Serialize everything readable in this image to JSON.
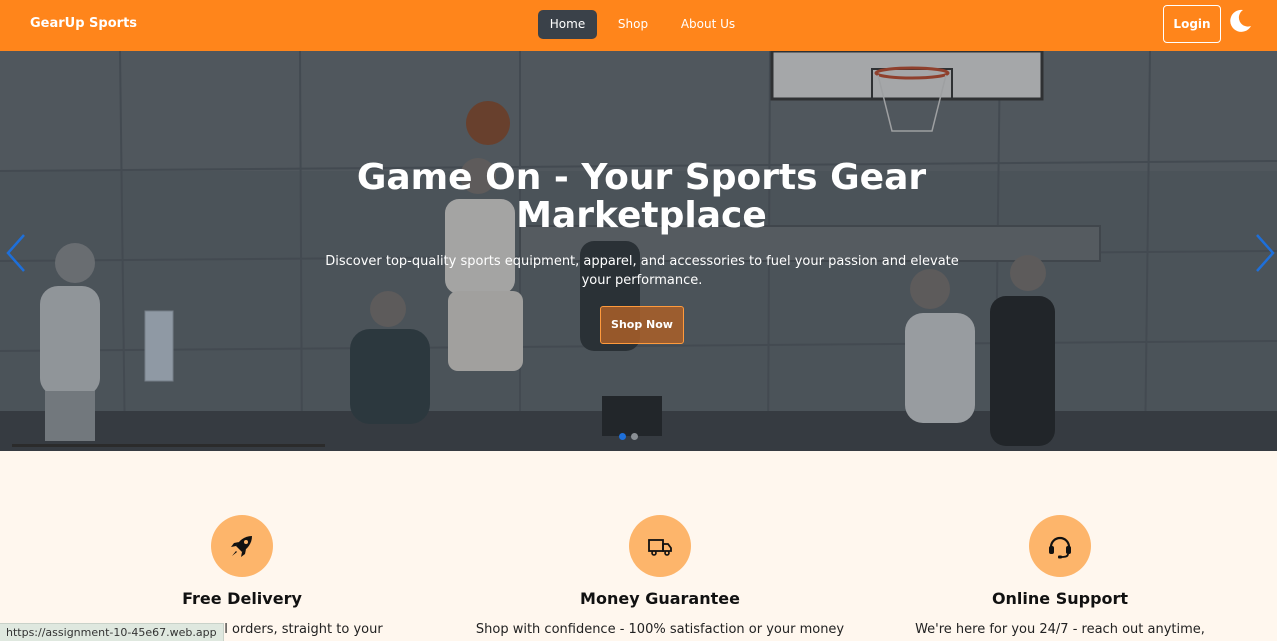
{
  "navbar": {
    "brand": "GearUp Sports",
    "links": [
      {
        "label": "Home",
        "active": true
      },
      {
        "label": "Shop",
        "active": false
      },
      {
        "label": "About Us",
        "active": false
      }
    ],
    "login_label": "Login",
    "theme_toggle_icon": "moon-icon",
    "bg_color": "#ff851b"
  },
  "hero": {
    "title": "Game On - Your Sports Gear Marketplace",
    "subtitle": "Discover top-quality sports equipment, apparel, and accessories to fuel your passion and elevate your performance.",
    "cta_label": "Shop Now",
    "prev_icon": "chevron-left-icon",
    "next_icon": "chevron-right-icon",
    "slide_progress": 0.25
  },
  "features": [
    {
      "icon": "rocket-icon",
      "title": "Free Delivery",
      "desc": "Free shipping on all orders, straight to your"
    },
    {
      "icon": "truck-icon",
      "title": "Money Guarantee",
      "desc": "Shop with confidence - 100% satisfaction or your money"
    },
    {
      "icon": "headset-icon",
      "title": "Online Support",
      "desc": "We're here for you 24/7 - reach out anytime,"
    }
  ],
  "status_bar": {
    "url": "https://assignment-10-45e67.web.app"
  },
  "colors": {
    "accent": "#ff851b",
    "feature_circle": "#fdb56b",
    "page_bg": "#fff7ee"
  }
}
